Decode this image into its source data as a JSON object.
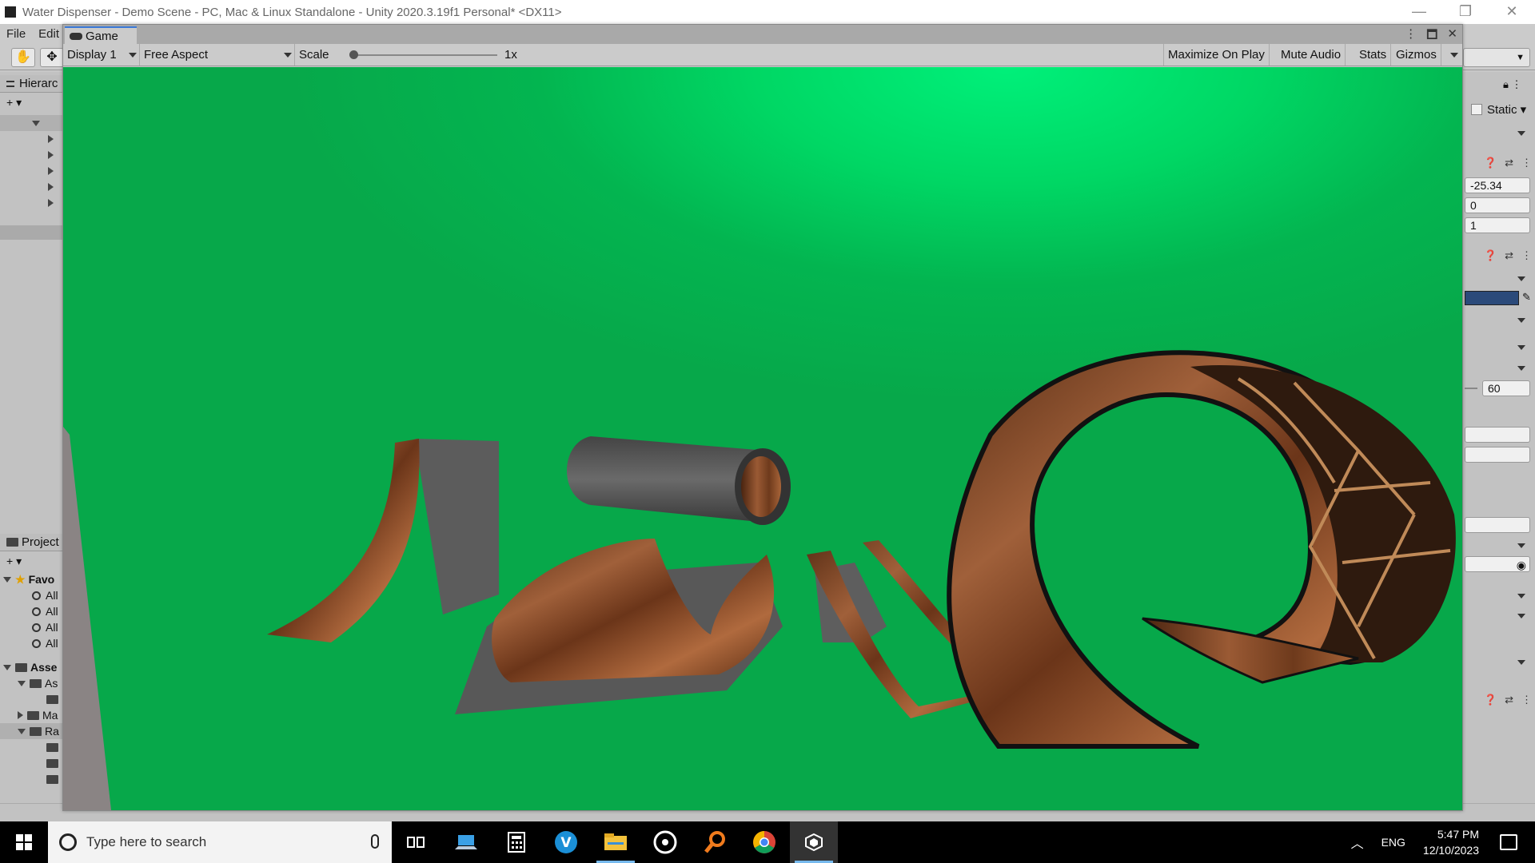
{
  "window": {
    "title": "Water Dispenser - Demo Scene - PC, Mac & Linux Standalone - Unity 2020.3.19f1 Personal* <DX11>",
    "minimize": "—",
    "restore": "❐",
    "close": "✕"
  },
  "menu": {
    "file": "File",
    "edit": "Edit"
  },
  "hierarchy": {
    "title": "Hierarc"
  },
  "project": {
    "title": "Project",
    "favorites_label": "Favo",
    "favorites": [
      "All",
      "All",
      "All",
      "All"
    ],
    "assets_label": "Asse",
    "assets_children": [
      "As",
      "Ma",
      "Ra"
    ]
  },
  "game": {
    "tab_label": "Game",
    "display": "Display 1",
    "aspect": "Free Aspect",
    "scale_label": "Scale",
    "scale_value": "1x",
    "maximize_on_play": "Maximize On Play",
    "mute_audio": "Mute Audio",
    "stats": "Stats",
    "gizmos": "Gizmos"
  },
  "inspector": {
    "static_label": "Static",
    "pos_x": "-25.34",
    "pos_y": "0",
    "pos_z": "1",
    "fov": "60",
    "accent_color": "#2b4a7a"
  },
  "taskbar": {
    "search_placeholder": "Type here to search",
    "language": "ENG",
    "time": "5:47 PM",
    "date": "12/10/2023",
    "apps": [
      "task-view-icon",
      "laptop-icon",
      "calculator-icon",
      "vimeo-icon",
      "file-explorer-icon",
      "music-icon",
      "search-app-icon",
      "chrome-icon",
      "unity-icon"
    ]
  }
}
